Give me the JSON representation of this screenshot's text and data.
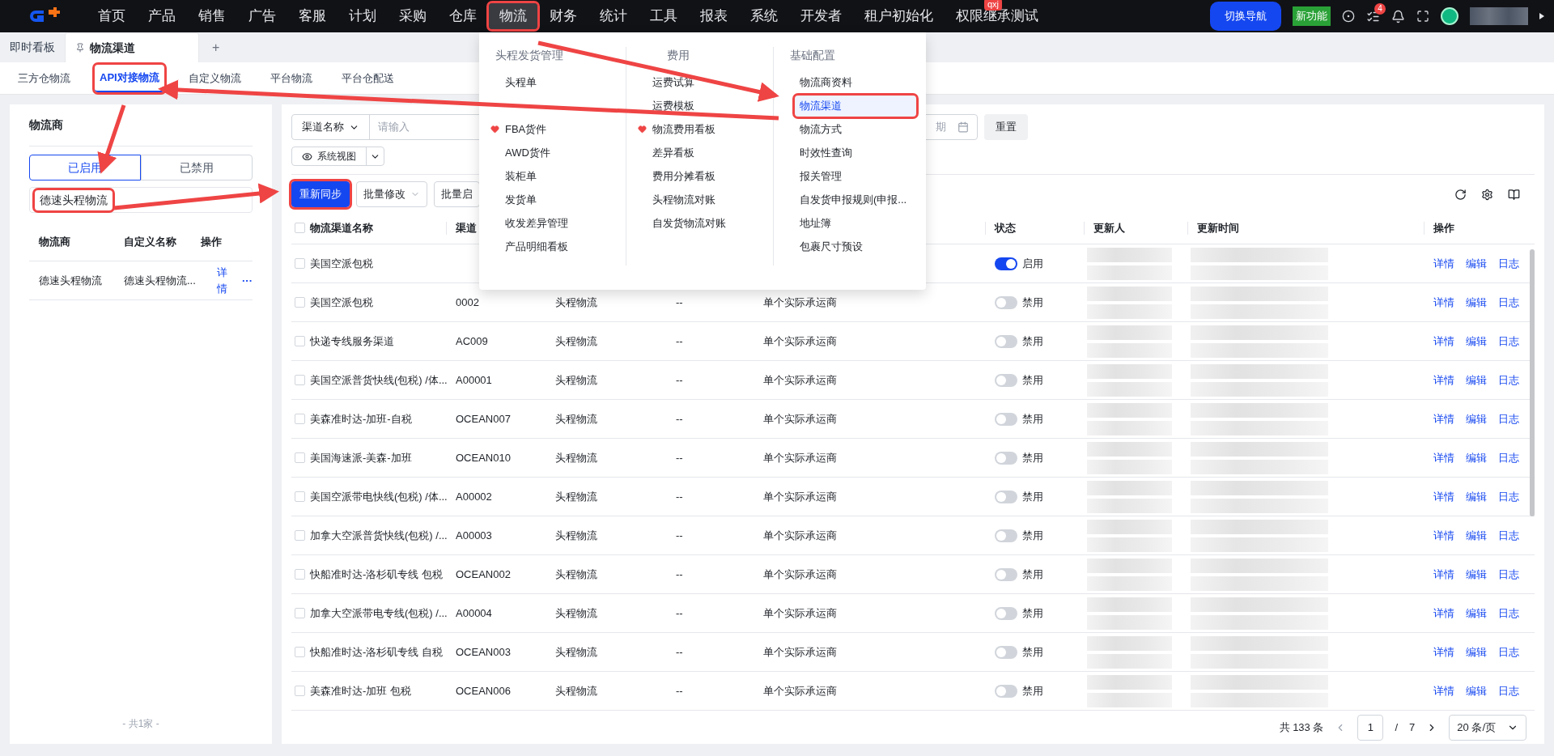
{
  "nav": {
    "items": [
      {
        "label": "首页",
        "selected": false,
        "annotated": false
      },
      {
        "label": "产品",
        "selected": false,
        "annotated": false
      },
      {
        "label": "销售",
        "selected": false,
        "annotated": false
      },
      {
        "label": "广告",
        "selected": false,
        "annotated": false
      },
      {
        "label": "客服",
        "selected": false,
        "annotated": false
      },
      {
        "label": "计划",
        "selected": false,
        "annotated": false
      },
      {
        "label": "采购",
        "selected": false,
        "annotated": false
      },
      {
        "label": "仓库",
        "selected": false,
        "annotated": false
      },
      {
        "label": "物流",
        "selected": true,
        "annotated": true
      },
      {
        "label": "财务",
        "selected": false,
        "annotated": false
      },
      {
        "label": "统计",
        "selected": false,
        "annotated": false
      },
      {
        "label": "工具",
        "selected": false,
        "annotated": false
      },
      {
        "label": "报表",
        "selected": false,
        "annotated": false
      },
      {
        "label": "系统",
        "selected": false,
        "annotated": false
      },
      {
        "label": "开发者",
        "selected": false,
        "annotated": false
      },
      {
        "label": "租户初始化",
        "selected": false,
        "annotated": false
      },
      {
        "label": "权限继承测试",
        "selected": false,
        "annotated": false,
        "badge": "qxj"
      }
    ],
    "switch_button": "切换导航",
    "new_feature": "新功能",
    "task_count": "4"
  },
  "page_tabs": [
    {
      "label": "即时看板",
      "selected": false,
      "pinned": false
    },
    {
      "label": "物流渠道",
      "selected": true,
      "pinned": true
    }
  ],
  "add_tab": "+",
  "sub_tabs": [
    {
      "label": "三方仓物流",
      "selected": false,
      "annotated": false
    },
    {
      "label": "API对接物流",
      "selected": true,
      "annotated": true
    },
    {
      "label": "自定义物流",
      "selected": false,
      "annotated": false
    },
    {
      "label": "平台物流",
      "selected": false,
      "annotated": false
    },
    {
      "label": "平台仓配送",
      "selected": false,
      "annotated": false
    }
  ],
  "carrier_panel": {
    "title": "物流商",
    "segments": [
      {
        "label": "已启用",
        "selected": true
      },
      {
        "label": "已禁用",
        "selected": false
      }
    ],
    "search": {
      "value": "德速头程物流",
      "annotated": true
    },
    "columns": [
      "物流商",
      "自定义名称",
      "操作"
    ],
    "rows": [
      {
        "carrier": "德速头程物流",
        "custom_name": "德速头程物流...",
        "action": "详情",
        "more": "···"
      }
    ],
    "footer": "- 共1家 -"
  },
  "filters": {
    "field_select": "渠道名称",
    "placeholder": "请输入",
    "date_tail": "期",
    "reset": "重置",
    "view": "系统视图"
  },
  "toolbar": {
    "buttons": [
      {
        "label": "重新同步",
        "kind": "primary",
        "annotated": true
      },
      {
        "label": "批量修改",
        "kind": "dropdown",
        "annotated": false
      },
      {
        "label": "批量启",
        "kind": "plain",
        "annotated": false
      }
    ]
  },
  "table": {
    "select_all_checked": false,
    "columns": [
      {
        "label": "物流渠道名称"
      },
      {
        "label": "渠道"
      },
      {},
      {},
      {},
      {
        "label": "状态"
      },
      {
        "label": "更新人"
      },
      {
        "label": "更新时间"
      },
      {
        "label": "操作"
      }
    ],
    "rows": [
      {
        "checked": false,
        "name": "美国空派包税",
        "enabled": true,
        "status": "启用",
        "actions": [
          "详情",
          "编辑",
          "日志"
        ]
      },
      {
        "checked": false,
        "name": "美国空派包税",
        "code": "0002",
        "type": "头程物流",
        "column_4": "--",
        "carrier": "单个实际承运商",
        "enabled": false,
        "status": "禁用",
        "actions": [
          "详情",
          "编辑",
          "日志"
        ]
      },
      {
        "checked": false,
        "name": "快递专线服务渠道",
        "code": "AC009",
        "type": "头程物流",
        "column_4": "--",
        "carrier": "单个实际承运商",
        "enabled": false,
        "status": "禁用",
        "actions": [
          "详情",
          "编辑",
          "日志"
        ]
      },
      {
        "checked": false,
        "name": "美国空派普货快线(包税) /体...",
        "code": "A00001",
        "type": "头程物流",
        "column_4": "--",
        "carrier": "单个实际承运商",
        "enabled": false,
        "status": "禁用",
        "actions": [
          "详情",
          "编辑",
          "日志"
        ]
      },
      {
        "checked": false,
        "name": "美森准时达-加班-自税",
        "code": "OCEAN007",
        "type": "头程物流",
        "column_4": "--",
        "carrier": "单个实际承运商",
        "enabled": false,
        "status": "禁用",
        "actions": [
          "详情",
          "编辑",
          "日志"
        ]
      },
      {
        "checked": false,
        "name": "美国海速派-美森-加班",
        "code": "OCEAN010",
        "type": "头程物流",
        "column_4": "--",
        "carrier": "单个实际承运商",
        "enabled": false,
        "status": "禁用",
        "actions": [
          "详情",
          "编辑",
          "日志"
        ]
      },
      {
        "checked": false,
        "name": "美国空派带电快线(包税) /体...",
        "code": "A00002",
        "type": "头程物流",
        "column_4": "--",
        "carrier": "单个实际承运商",
        "enabled": false,
        "status": "禁用",
        "actions": [
          "详情",
          "编辑",
          "日志"
        ]
      },
      {
        "checked": false,
        "name": "加拿大空派普货快线(包税) /...",
        "code": "A00003",
        "type": "头程物流",
        "column_4": "--",
        "carrier": "单个实际承运商",
        "enabled": false,
        "status": "禁用",
        "actions": [
          "详情",
          "编辑",
          "日志"
        ]
      },
      {
        "checked": false,
        "name": "快船准时达-洛杉矶专线 包税",
        "code": "OCEAN002",
        "type": "头程物流",
        "column_4": "--",
        "carrier": "单个实际承运商",
        "enabled": false,
        "status": "禁用",
        "actions": [
          "详情",
          "编辑",
          "日志"
        ]
      },
      {
        "checked": false,
        "name": "加拿大空派带电专线(包税) /...",
        "code": "A00004",
        "type": "头程物流",
        "column_4": "--",
        "carrier": "单个实际承运商",
        "enabled": false,
        "status": "禁用",
        "actions": [
          "详情",
          "编辑",
          "日志"
        ]
      },
      {
        "checked": false,
        "name": "快船准时达-洛杉矶专线 自税",
        "code": "OCEAN003",
        "type": "头程物流",
        "column_4": "--",
        "carrier": "单个实际承运商",
        "enabled": false,
        "status": "禁用",
        "actions": [
          "详情",
          "编辑",
          "日志"
        ]
      },
      {
        "checked": false,
        "name": "美森准时达-加班 包税",
        "code": "OCEAN006",
        "type": "头程物流",
        "column_4": "--",
        "carrier": "单个实际承运商",
        "enabled": false,
        "status": "禁用",
        "actions": [
          "详情",
          "编辑",
          "日志"
        ]
      }
    ]
  },
  "pagination": {
    "total": "共 133 条",
    "page": "1",
    "separator": "/",
    "pages": "7",
    "page_size": "20 条/页"
  },
  "nav_menu": {
    "columns": [
      {
        "header": "头程发货管理",
        "items": [
          {
            "label": "头程单",
            "favorite": false,
            "selected": false,
            "annotated": false
          },
          {
            "label": "FBA货件",
            "favorite": true,
            "selected": false,
            "annotated": false
          },
          {
            "label": "AWD货件",
            "favorite": false,
            "selected": false,
            "annotated": false
          },
          {
            "label": "装柜单",
            "favorite": false,
            "selected": false,
            "annotated": false
          },
          {
            "label": "发货单",
            "favorite": false,
            "selected": false,
            "annotated": false
          },
          {
            "label": "收发差异管理",
            "favorite": false,
            "selected": false,
            "annotated": false
          },
          {
            "label": "产品明细看板",
            "favorite": false,
            "selected": false,
            "annotated": false
          }
        ]
      },
      {
        "header": "费用",
        "items": [
          {
            "label": "运费试算",
            "favorite": false,
            "selected": false,
            "annotated": false
          },
          {
            "label": "运费模板",
            "favorite": false,
            "selected": false,
            "annotated": false
          },
          {
            "label": "物流费用看板",
            "favorite": true,
            "selected": false,
            "annotated": false
          },
          {
            "label": "差异看板",
            "favorite": false,
            "selected": false,
            "annotated": false
          },
          {
            "label": "费用分摊看板",
            "favorite": false,
            "selected": false,
            "annotated": false
          },
          {
            "label": "头程物流对账",
            "favorite": false,
            "selected": false,
            "annotated": false
          },
          {
            "label": "自发货物流对账",
            "favorite": false,
            "selected": false,
            "annotated": false
          }
        ]
      },
      {
        "header": "基础配置",
        "items": [
          {
            "label": "物流商资料",
            "favorite": false,
            "selected": false,
            "annotated": false
          },
          {
            "label": "物流渠道",
            "favorite": false,
            "selected": true,
            "annotated": true
          },
          {
            "label": "物流方式",
            "favorite": false,
            "selected": false,
            "annotated": false
          },
          {
            "label": "时效性查询",
            "favorite": false,
            "selected": false,
            "annotated": false
          },
          {
            "label": "报关管理",
            "favorite": false,
            "selected": false,
            "annotated": false
          },
          {
            "label": "自发货申报规则(申报...",
            "favorite": false,
            "selected": false,
            "annotated": false
          },
          {
            "label": "地址簿",
            "favorite": false,
            "selected": false,
            "annotated": false
          },
          {
            "label": "包裹尺寸预设",
            "favorite": false,
            "selected": false,
            "annotated": false
          }
        ]
      }
    ]
  }
}
